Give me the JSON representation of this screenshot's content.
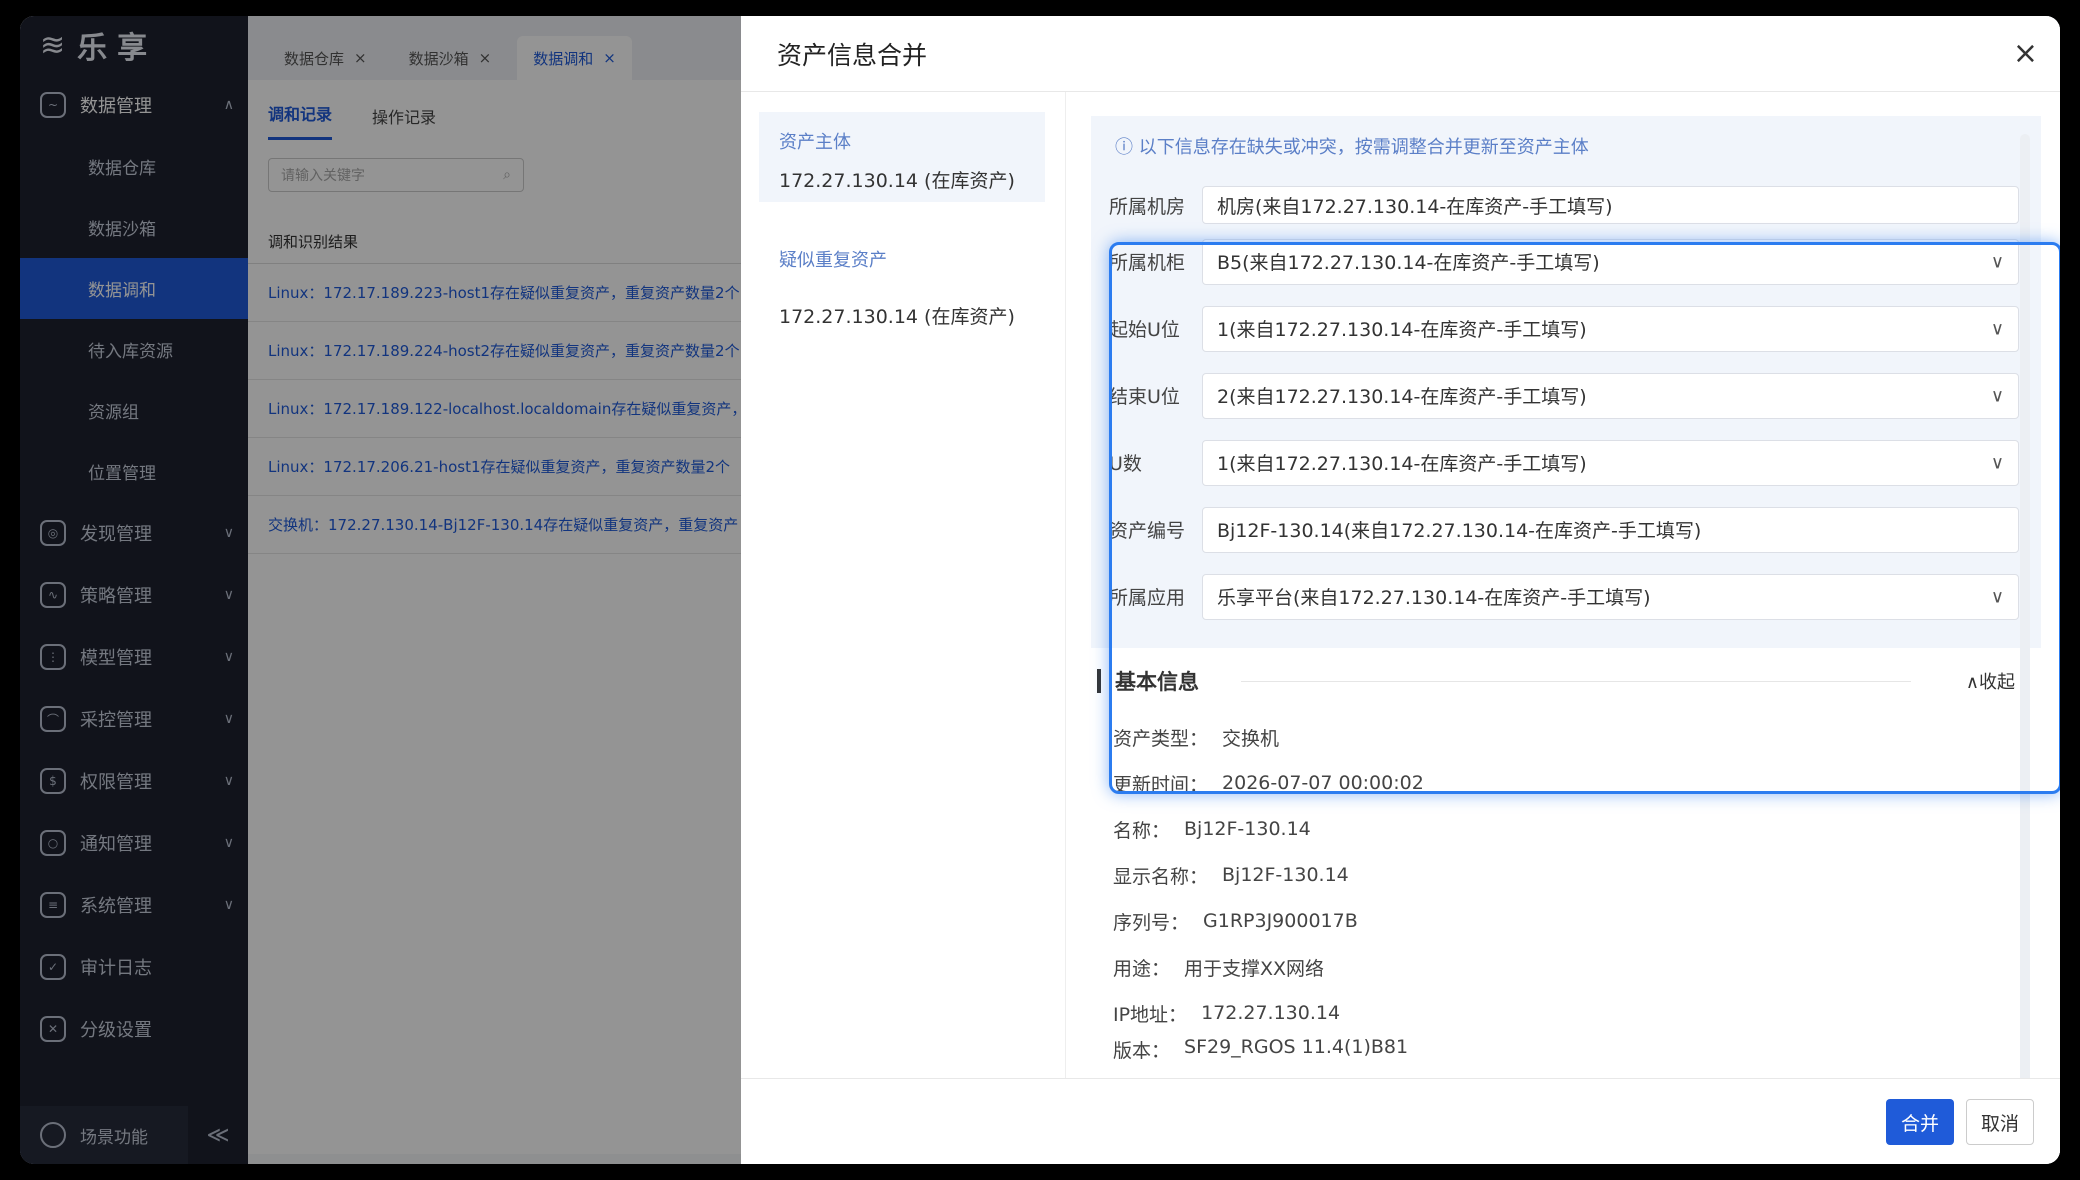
{
  "app": {
    "logo_mark": "≋",
    "logo_name": "乐享"
  },
  "sidebar": {
    "groups": [
      {
        "label": "数据管理",
        "icon": "data-icon",
        "arrow": "∧"
      },
      {
        "label": "发现管理",
        "icon": "discover-icon",
        "arrow": "∨"
      },
      {
        "label": "策略管理",
        "icon": "policy-icon",
        "arrow": "∨"
      },
      {
        "label": "模型管理",
        "icon": "model-icon",
        "arrow": "∨"
      },
      {
        "label": "采控管理",
        "icon": "collect-icon",
        "arrow": "∨"
      },
      {
        "label": "权限管理",
        "icon": "permission-icon",
        "arrow": "∨"
      },
      {
        "label": "通知管理",
        "icon": "notify-icon",
        "arrow": "∨"
      },
      {
        "label": "系统管理",
        "icon": "system-icon",
        "arrow": "∨"
      },
      {
        "label": "审计日志",
        "icon": "audit-icon"
      },
      {
        "label": "分级设置",
        "icon": "tools-icon"
      }
    ],
    "subitems": [
      "数据仓库",
      "数据沙箱",
      "数据调和",
      "待入库资源",
      "资源组",
      "位置管理"
    ],
    "bottom_label": "场景功能",
    "collapse_glyph": "≪"
  },
  "main": {
    "tabs": [
      {
        "label": "数据仓库",
        "close": "×"
      },
      {
        "label": "数据沙箱",
        "close": "×"
      },
      {
        "label": "数据调和",
        "close": "×"
      }
    ],
    "subtabs": [
      "调和记录",
      "操作记录"
    ],
    "search_placeholder": "请输入关键字",
    "search_icon": "⌕",
    "list_header": "调和识别结果",
    "rows": [
      "Linux：172.17.189.223-host1存在疑似重复资产，重复资产数量2个",
      "Linux：172.17.189.224-host2存在疑似重复资产，重复资产数量2个",
      "Linux：172.17.189.122-localhost.localdomain存在疑似重复资产，",
      "Linux：172.17.206.21-host1存在疑似重复资产，重复资产数量2个",
      "交换机：172.27.130.14-Bj12F-130.14存在疑似重复资产，重复资产"
    ]
  },
  "drawer": {
    "title": "资产信息合并",
    "close": "×",
    "subject_label": "资产主体",
    "subject_value": "172.27.130.14 (在库资产)",
    "duplicate_label": "疑似重复资产",
    "duplicate_value": "172.27.130.14 (在库资产)",
    "notice": "ⓘ 以下信息存在缺失或冲突，按需调整合并更新至资产主体",
    "fields": [
      {
        "label": "所属机房",
        "value": "机房(来自172.27.130.14-在库资产-手工填写)",
        "chevron": ""
      },
      {
        "label": "所属机柜",
        "value": "B5(来自172.27.130.14-在库资产-手工填写)",
        "chevron": "∨"
      },
      {
        "label": "起始U位",
        "value": "1(来自172.27.130.14-在库资产-手工填写)",
        "chevron": "∨"
      },
      {
        "label": "结束U位",
        "value": "2(来自172.27.130.14-在库资产-手工填写)",
        "chevron": "∨"
      },
      {
        "label": "U数",
        "value": "1(来自172.27.130.14-在库资产-手工填写)",
        "chevron": "∨"
      },
      {
        "label": "资产编号",
        "value": "Bj12F-130.14(来自172.27.130.14-在库资产-手工填写)",
        "chevron": ""
      },
      {
        "label": "所属应用",
        "value": "乐享平台(来自172.27.130.14-在库资产-手工填写)",
        "chevron": "∨"
      }
    ],
    "basic_title": "基本信息",
    "basic_toggle": "∧收起",
    "info": [
      {
        "k": "资产类型：",
        "v": "交换机"
      },
      {
        "k": "更新时间：",
        "v": "2026-07-07 00:00:02"
      },
      {
        "k": "名称：",
        "v": "Bj12F-130.14"
      },
      {
        "k": "显示名称：",
        "v": "Bj12F-130.14"
      },
      {
        "k": "序列号：",
        "v": "G1RP3J900017B"
      },
      {
        "k": "用途：",
        "v": "用于支撑XX网络"
      },
      {
        "k": "IP地址：",
        "v": "172.27.130.14"
      },
      {
        "k": "版本：",
        "v": "SF29_RGOS 11.4(1)B81"
      }
    ],
    "merge_label": "合并",
    "cancel_label": "取消"
  },
  "colors": {
    "primary": "#1f5bd9",
    "sidebar_bg": "#1e2230",
    "highlight": "#2b7cf0"
  }
}
